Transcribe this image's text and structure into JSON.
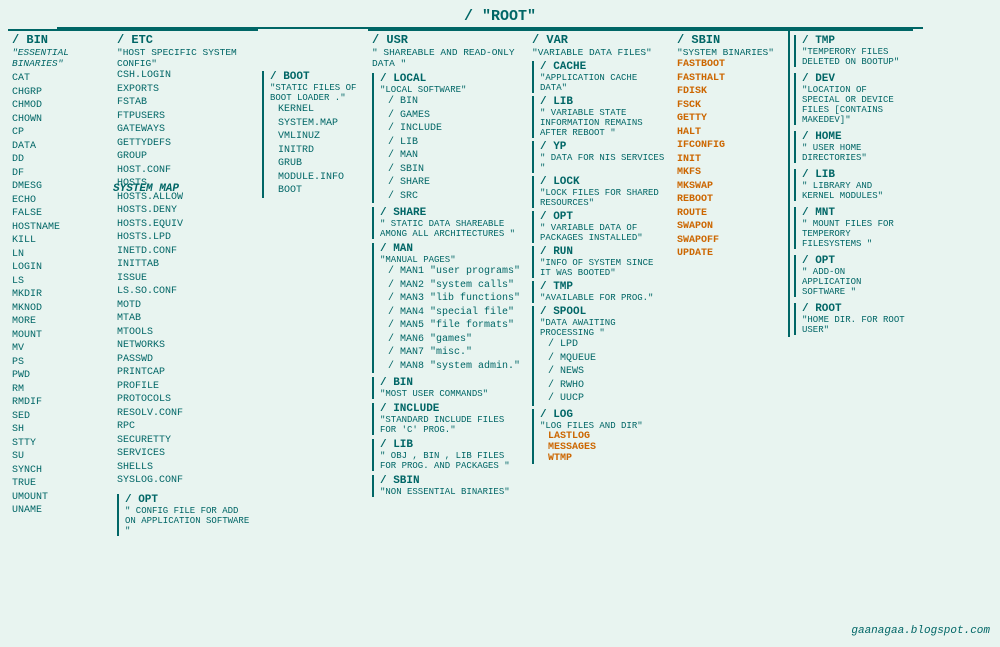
{
  "root": {
    "title": "/   \"ROOT\""
  },
  "sysmap": "SYSTEM MAP",
  "watermark": "gaanagaa.blogspot.com",
  "columns": {
    "bin": {
      "title": "/ BIN",
      "desc": "\"ESSENTIAL BINARIES\"",
      "items": [
        "CAT",
        "CHGRP",
        "CHMOD",
        "CHOWN",
        "CP",
        "DATA",
        "DD",
        "DF",
        "DMESG",
        "ECHO",
        "FALSE",
        "HOSTNAME",
        "KILL",
        "LN",
        "LOGIN",
        "LS",
        "MKDIR",
        "MKNOD",
        "MORE",
        "MOUNT",
        "MV",
        "PS",
        "PWD",
        "RM",
        "RMDIF",
        "SED",
        "SH",
        "STTY",
        "SU",
        "SYNCH",
        "TRUE",
        "UMOUNT",
        "UNAME"
      ]
    },
    "etc": {
      "title": "/ ETC",
      "desc": "\"HOST SPECIFIC SYSTEM CONFIG\"",
      "items": [
        "CSH.LOGIN",
        "EXPORTS",
        "FSTAB",
        "FTPUSERS",
        "GATEWAYS",
        "GETTYDEFS",
        "GROUP",
        "HOST.CONF",
        "HOSTS",
        "HOSTS.ALLOW",
        "HOSTS.DENY",
        "HOSTS.EQUIV",
        "HOSTS.LPD",
        "INETD.CONF",
        "INITTAB",
        "ISSUE",
        "LS.SO.CONF",
        "MOTD",
        "MTAB",
        "MTOOLS",
        "NETWORKS",
        "PASSWD",
        "PRINTCAP",
        "PROFILE",
        "PROTOCOLS",
        "RESOLV.CONF",
        "RPC",
        "SECURETTY",
        "SERVICES",
        "SHELLS",
        "SYSLOG.CONF"
      ],
      "opt": {
        "title": "/ OPT",
        "desc": "\" CONFIG FILE FOR ADD ON APPLICATION SOFTWARE \""
      }
    },
    "boot": {
      "title": "/ BOOT",
      "desc": "\"STATIC FILES OF BOOT LOADER .\"",
      "items": [
        "KERNEL",
        "SYSTEM.MAP",
        "VMLINUZ",
        "INITRD",
        "GRUB",
        "MODULE.INFO",
        "BOOT"
      ]
    },
    "usr": {
      "title": "/ USR",
      "desc": "\" SHAREABLE AND READ-ONLY DATA \"",
      "local": {
        "title": "/ LOCAL",
        "desc": "\"LOCAL SOFTWARE\"",
        "subitems": [
          "/ BIN",
          "/ GAMES",
          "/ INCLUDE",
          "/ LIB",
          "/ MAN",
          "/ SBIN",
          "/ SHARE",
          "/ SRC"
        ]
      },
      "share": {
        "title": "/ SHARE",
        "desc": "\" STATIC DATA SHAREABLE AMONG ALL ARCHITECTURES \""
      },
      "man": {
        "title": "/ MAN",
        "desc": "\"MANUAL PAGES\"",
        "subitems": [
          "/ MAN1 \"user programs\"",
          "/ MAN2 \"system calls\"",
          "/ MAN3 \"lib functions\"",
          "/ MAN4 \"special file\"",
          "/ MAN5 \"file formats\"",
          "/ MAN6 \"games\"",
          "/ MAN7 \"misc.\"",
          "/ MAN8 \"system admin.\""
        ]
      },
      "bin": {
        "title": "/ BIN",
        "desc": "\"MOST USER COMMANDS\""
      },
      "include": {
        "title": "/ INCLUDE",
        "desc": "\"STANDARD INCLUDE FILES FOR 'C' PROG.\""
      },
      "lib": {
        "title": "/ LIB",
        "desc": "\" OBJ , BIN , LIB FILES FOR PROG. AND PACKAGES \""
      },
      "sbin": {
        "title": "/ SBIN",
        "desc": "\"NON ESSENTIAL BINARIES\""
      }
    },
    "var": {
      "title": "/ VAR",
      "desc": "\"VARIABLE DATA FILES\"",
      "cache": {
        "title": "/ CACHE",
        "desc": "\"APPLICATION CACHE DATA\""
      },
      "lib": {
        "title": "/ LIB",
        "desc": "\" VARIABLE STATE INFORMATION REMAINS AFTER REBOOT \""
      },
      "yp": {
        "title": "/ YP",
        "desc": "\" DATA FOR NIS SERVICES \""
      },
      "lock": {
        "title": "/ LOCK",
        "desc": "\"LOCK FILES FOR SHARED RESOURCES\""
      },
      "opt": {
        "title": "/ OPT",
        "desc": "\" VARIABLE DATA OF PACKAGES INSTALLED\""
      },
      "run": {
        "title": "/ RUN",
        "desc": "\"INFO OF SYSTEM SINCE IT WAS BOOTED\""
      },
      "tmp": {
        "title": "/ TMP",
        "desc": "\"AVAILABLE FOR PROG.\""
      },
      "spool": {
        "title": "/ SPOOL",
        "desc": "\"DATA AWAITING PROCESSING \"",
        "subitems": [
          "/ LPD",
          "/ MQUEUE",
          "/ NEWS",
          "/ RWHO",
          "/ UUCP"
        ]
      },
      "log": {
        "title": "/ LOG",
        "desc": "\"LOG FILES AND DIR\"",
        "items_orange": [
          "LASTLOG",
          "MESSAGES",
          "WTMP"
        ]
      }
    },
    "sbin": {
      "title": "/ SBIN",
      "desc": "\"SYSTEM BINARIES\"",
      "items_orange": [
        "FASTBOOT",
        "FASTHALT",
        "FDISK",
        "FSCK",
        "GETTY",
        "HALT",
        "IFCONFIG",
        "INIT",
        "MKFS",
        "MKSWAP",
        "REBOOT",
        "ROUTE",
        "SWAPON",
        "SWAPOFF",
        "UPDATE"
      ]
    },
    "right": {
      "tmp": {
        "title": "/ TMP",
        "desc": "\"TEMPERORY FILES DELETED ON BOOTUP\""
      },
      "dev": {
        "title": "/ DEV",
        "desc": "\"LOCATION OF SPECIAL OR DEVICE FILES [CONTAINS MAKEDEV]\""
      },
      "home": {
        "title": "/ HOME",
        "desc": "\" USER HOME DIRECTORIES\""
      },
      "lib": {
        "title": "/ LIB",
        "desc": "\"  LIBRARY AND KERNEL MODULES\""
      },
      "mnt": {
        "title": "/ MNT",
        "desc": "\" MOUNT FILES FOR TEMPERORY FILESYSTEMS \""
      },
      "opt": {
        "title": "/ OPT",
        "desc": "\" ADD-ON APPLICATION SOFTWARE \""
      },
      "root": {
        "title": "/ ROOT",
        "desc": "\"HOME DIR. FOR ROOT USER\""
      }
    }
  }
}
